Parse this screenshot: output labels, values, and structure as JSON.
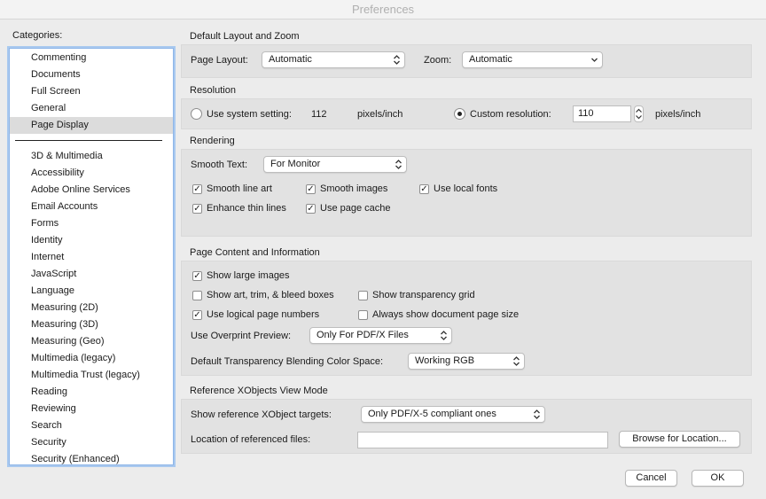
{
  "window": {
    "title": "Preferences"
  },
  "categories": {
    "label": "Categories:",
    "top_items": [
      "Commenting",
      "Documents",
      "Full Screen",
      "General",
      "Page Display"
    ],
    "selected": "Page Display",
    "items": [
      "3D & Multimedia",
      "Accessibility",
      "Adobe Online Services",
      "Email Accounts",
      "Forms",
      "Identity",
      "Internet",
      "JavaScript",
      "Language",
      "Measuring (2D)",
      "Measuring (3D)",
      "Measuring (Geo)",
      "Multimedia (legacy)",
      "Multimedia Trust (legacy)",
      "Reading",
      "Reviewing",
      "Search",
      "Security",
      "Security (Enhanced)"
    ]
  },
  "layout_zoom": {
    "title": "Default Layout and Zoom",
    "page_layout_label": "Page Layout:",
    "page_layout_value": "Automatic",
    "zoom_label": "Zoom:",
    "zoom_value": "Automatic"
  },
  "resolution": {
    "title": "Resolution",
    "system_label": "Use system setting:",
    "system_value": "112",
    "system_unit": "pixels/inch",
    "custom_label": "Custom resolution:",
    "custom_value": "110",
    "custom_unit": "pixels/inch",
    "selected": "custom"
  },
  "rendering": {
    "title": "Rendering",
    "smooth_text_label": "Smooth Text:",
    "smooth_text_value": "For Monitor",
    "smooth_line_art": "Smooth line art",
    "smooth_images": "Smooth images",
    "use_local_fonts": "Use local fonts",
    "enhance_thin_lines": "Enhance thin lines",
    "use_page_cache": "Use page cache"
  },
  "page_content": {
    "title": "Page Content and Information",
    "show_large_images": "Show large images",
    "show_art_trim": "Show art, trim, & bleed boxes",
    "show_transparency_grid": "Show transparency grid",
    "use_logical_page_numbers": "Use logical page numbers",
    "always_show_page_size": "Always show document page size",
    "overprint_label": "Use Overprint Preview:",
    "overprint_value": "Only For PDF/X Files",
    "blending_label": "Default Transparency Blending Color Space:",
    "blending_value": "Working RGB"
  },
  "xobjects": {
    "title": "Reference XObjects View Mode",
    "targets_label": "Show reference XObject targets:",
    "targets_value": "Only PDF/X-5 compliant ones",
    "location_label": "Location of referenced files:",
    "location_value": "",
    "browse_label": "Browse for Location..."
  },
  "footer": {
    "cancel_label": "Cancel",
    "ok_label": "OK"
  },
  "check_mark": "✓"
}
